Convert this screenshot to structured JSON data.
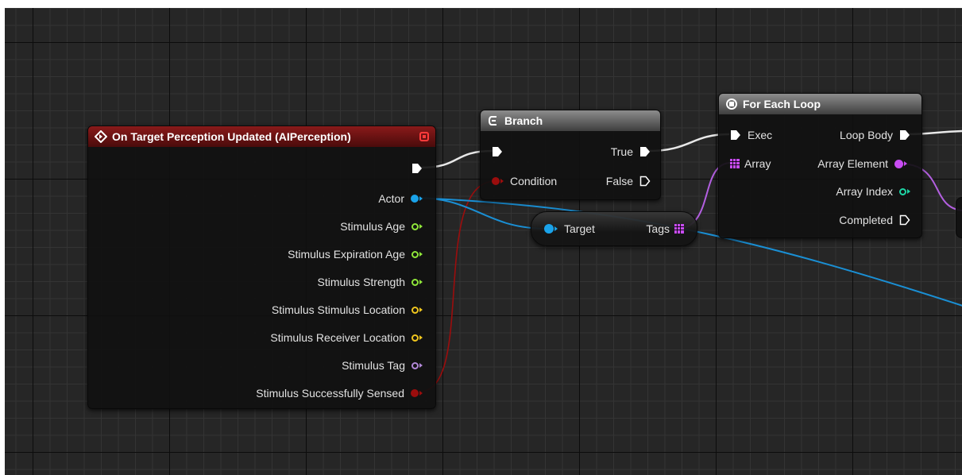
{
  "colors": {
    "event_header": "#8a1a1a",
    "macro_header": "#8c8c8c",
    "exec": "#ffffff",
    "object": "#1aa3ea",
    "float": "#8fe63a",
    "vector": "#f0c61e",
    "name": "#b288d8",
    "bool": "#9b0d0d",
    "int": "#1ed6a6",
    "array": "#c84cf2"
  },
  "event_node": {
    "icon": "diamond-event-icon",
    "title": "On Target Perception Updated (AIPerception)",
    "pins": [
      {
        "label": "Actor",
        "type": "object"
      },
      {
        "label": "Stimulus Age",
        "type": "float"
      },
      {
        "label": "Stimulus Expiration Age",
        "type": "float"
      },
      {
        "label": "Stimulus Strength",
        "type": "float"
      },
      {
        "label": "Stimulus Stimulus Location",
        "type": "vector"
      },
      {
        "label": "Stimulus Receiver Location",
        "type": "vector"
      },
      {
        "label": "Stimulus Tag",
        "type": "name"
      },
      {
        "label": "Stimulus Successfully Sensed",
        "type": "bool"
      }
    ]
  },
  "branch_node": {
    "icon": "branch-icon",
    "title": "Branch",
    "condition_label": "Condition",
    "true_label": "True",
    "false_label": "False"
  },
  "get_tags_node": {
    "target_label": "Target",
    "tags_label": "Tags"
  },
  "foreach_node": {
    "icon": "loop-icon",
    "title": "For Each Loop",
    "exec_label": "Exec",
    "array_label": "Array",
    "loop_body_label": "Loop Body",
    "array_element_label": "Array Element",
    "array_index_label": "Array Index",
    "completed_label": "Completed"
  }
}
